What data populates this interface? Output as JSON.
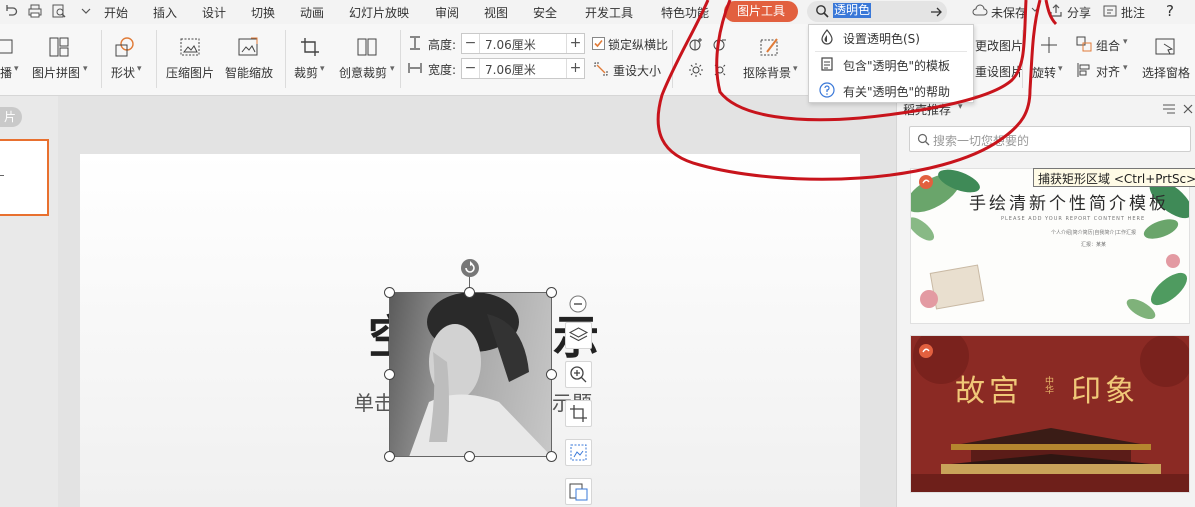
{
  "menubar": {
    "tabs": [
      "开始",
      "插入",
      "设计",
      "切换",
      "动画",
      "幻灯片放映",
      "审阅",
      "视图",
      "安全",
      "开发工具",
      "特色功能"
    ],
    "active_tab": "图片工具",
    "search_text": "透明色",
    "unsaved": "未保存",
    "share": "分享",
    "annotate": "批注",
    "help": "?"
  },
  "ribbon": {
    "broadcast": "播",
    "picture_collage": "图片拼图",
    "shape": "形状",
    "compress": "压缩图片",
    "smart_zoom": "智能缩放",
    "crop": "裁剪",
    "creative_crop": "创意裁剪",
    "height_label": "高度:",
    "height_value": "7.06厘米",
    "width_label": "宽度:",
    "width_value": "7.06厘米",
    "lock_ratio": "锁定纵横比",
    "reset_size": "重设大小",
    "remove_bg": "抠除背景",
    "change_pic": "更改图片",
    "reset_pic": "重设图片",
    "rotate": "旋转",
    "group": "组合",
    "align": "对齐",
    "selection_pane": "选择窗格",
    "minus": "−",
    "plus": "+"
  },
  "dropdown": {
    "items": [
      "设置透明色(S)",
      "包含\"透明色\"的模板",
      "有关\"透明色\"的帮助"
    ]
  },
  "left_panel": {
    "tab_label": "片"
  },
  "slide": {
    "title_partial": "空",
    "title_right": "示",
    "subtitle_left": "单击",
    "subtitle_right": "示题"
  },
  "right_panel": {
    "title": "稻壳推荐",
    "search_placeholder": "搜索一切您想要的",
    "tooltip": "捕获矩形区域 <Ctrl+PrtSc>",
    "template1": {
      "title": "手绘清新个性简介模板",
      "subtitle": "PLEASE ADD YOUR REPORT CONTENT HERE",
      "tagline": "个人介绍|简介简历|自我简介|工作汇报",
      "reporter": "汇报：某某"
    },
    "template2": {
      "title_left": "故宫",
      "title_mid": "中华",
      "title_right": "印象"
    }
  },
  "colors": {
    "accent": "#e2603f",
    "annotation": "#c8141c",
    "selection_blue": "#3a78d8",
    "thumb_border": "#e8702f",
    "palace_red": "#8b2a24"
  }
}
